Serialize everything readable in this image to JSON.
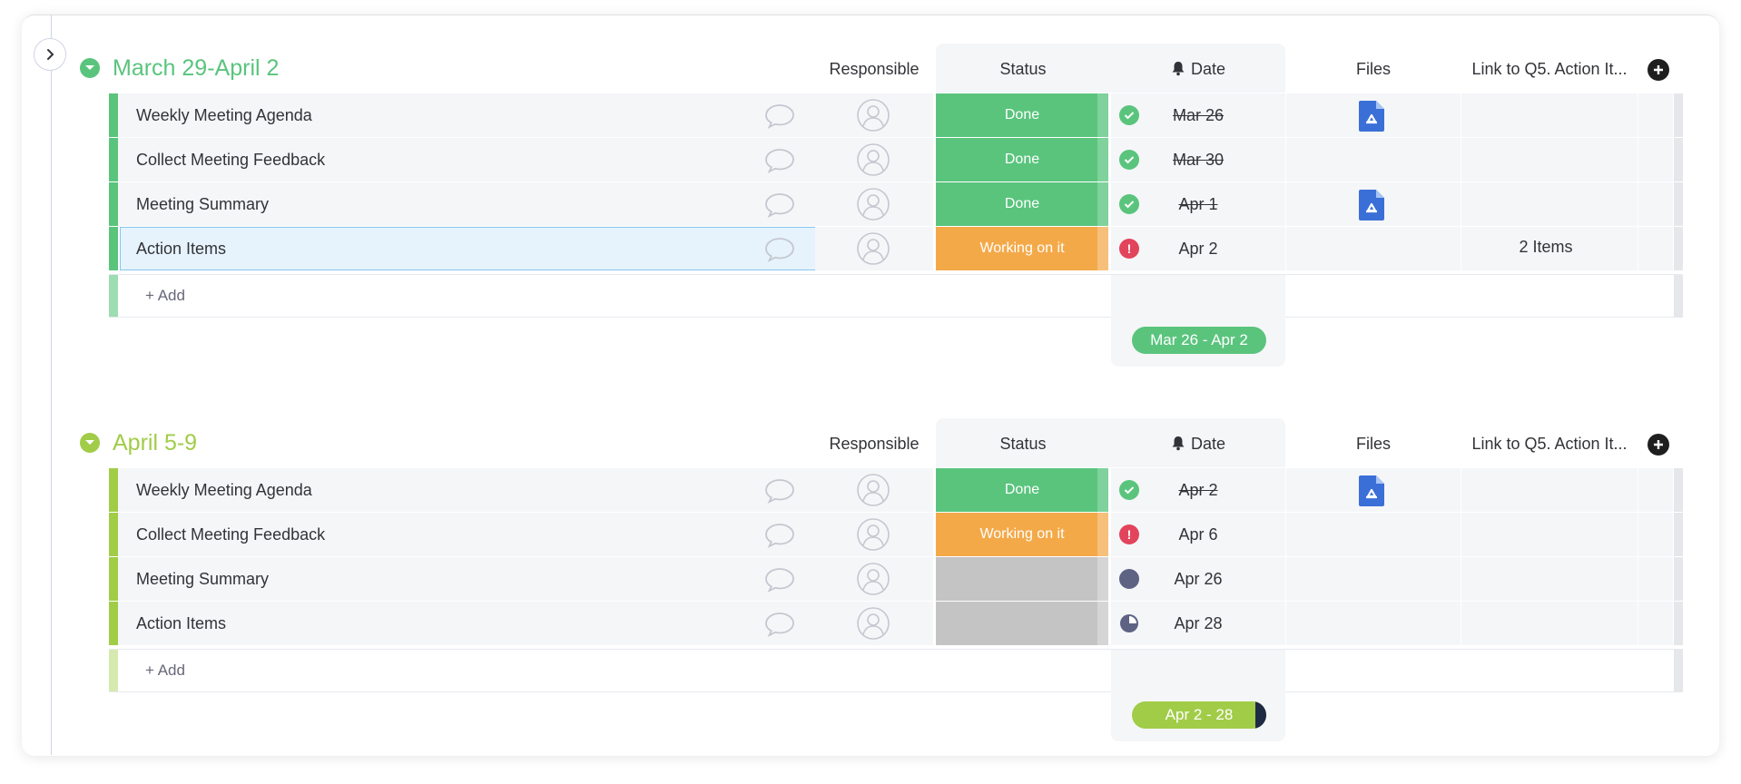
{
  "columns": {
    "responsible": "Responsible",
    "status": "Status",
    "date": "Date",
    "files": "Files",
    "link": "Link to Q5. Action It..."
  },
  "add_label": "+ Add",
  "colors": {
    "done": "#5ac47d",
    "working": "#f4a949",
    "empty_status": "#c4c4c4",
    "group1": "#5ac47d",
    "group2": "#a1cc48",
    "overdue": "#e2445c",
    "pending": "#5e6384",
    "drive": "#3b6fd8"
  },
  "groups": [
    {
      "title": "March 29-April 2",
      "color": "#5ac47d",
      "summary": "Mar 26 - Apr 2",
      "rows": [
        {
          "name": "Weekly Meeting Agenda",
          "status": "Done",
          "date": "Mar 26",
          "date_state": "done",
          "file": true,
          "link": ""
        },
        {
          "name": "Collect Meeting Feedback",
          "status": "Done",
          "date": "Mar 30",
          "date_state": "done",
          "file": false,
          "link": ""
        },
        {
          "name": "Meeting Summary",
          "status": "Done",
          "date": "Apr 1",
          "date_state": "done",
          "file": true,
          "link": ""
        },
        {
          "name": "Action Items",
          "status": "Working on it",
          "date": "Apr 2",
          "date_state": "overdue",
          "file": false,
          "link": "2 Items"
        }
      ]
    },
    {
      "title": "April 5-9",
      "color": "#a1cc48",
      "summary": "Apr 2 - 28",
      "rows": [
        {
          "name": "Weekly Meeting Agenda",
          "status": "Done",
          "date": "Apr 2",
          "date_state": "done",
          "file": true,
          "link": ""
        },
        {
          "name": "Collect Meeting Feedback",
          "status": "Working on it",
          "date": "Apr 6",
          "date_state": "overdue",
          "file": false,
          "link": ""
        },
        {
          "name": "Meeting Summary",
          "status": "",
          "date": "Apr 26",
          "date_state": "pending",
          "file": false,
          "link": ""
        },
        {
          "name": "Action Items",
          "status": "",
          "date": "Apr 28",
          "date_state": "pending-partial",
          "file": false,
          "link": ""
        }
      ]
    }
  ]
}
